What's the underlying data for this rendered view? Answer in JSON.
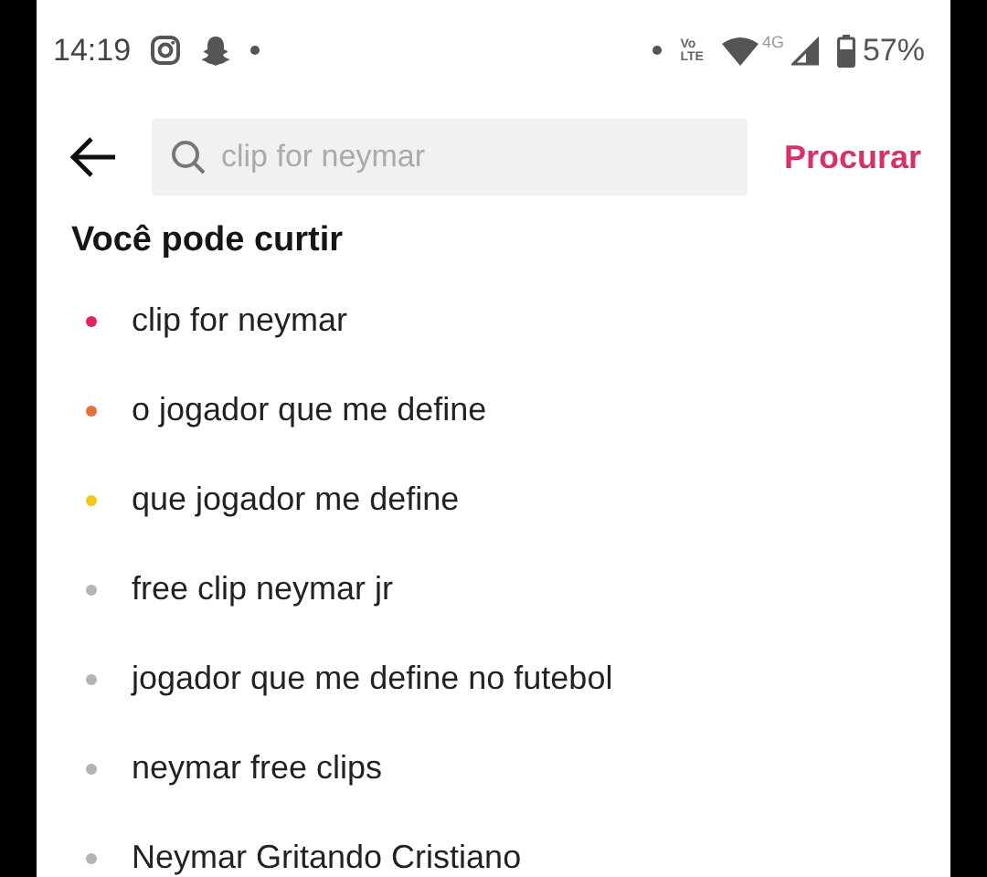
{
  "status_bar": {
    "time": "14:19",
    "volte": [
      "Vo",
      "LTE"
    ],
    "network": "4G",
    "battery": "57%"
  },
  "search": {
    "placeholder": "clip for neymar",
    "action": "Procurar"
  },
  "suggestions": {
    "title": "Você pode curtir",
    "items": [
      {
        "text": "clip for neymar",
        "color": "#e0245e"
      },
      {
        "text": "o jogador que me define",
        "color": "#e8703a"
      },
      {
        "text": "que jogador me define",
        "color": "#f5c518"
      },
      {
        "text": "free clip neymar jr",
        "color": "#b4b4b4"
      },
      {
        "text": "jogador que me define no futebol",
        "color": "#b4b4b4"
      },
      {
        "text": "neymar free clips",
        "color": "#b4b4b4"
      },
      {
        "text": "Neymar Gritando Cristiano",
        "color": "#b4b4b4"
      }
    ]
  }
}
